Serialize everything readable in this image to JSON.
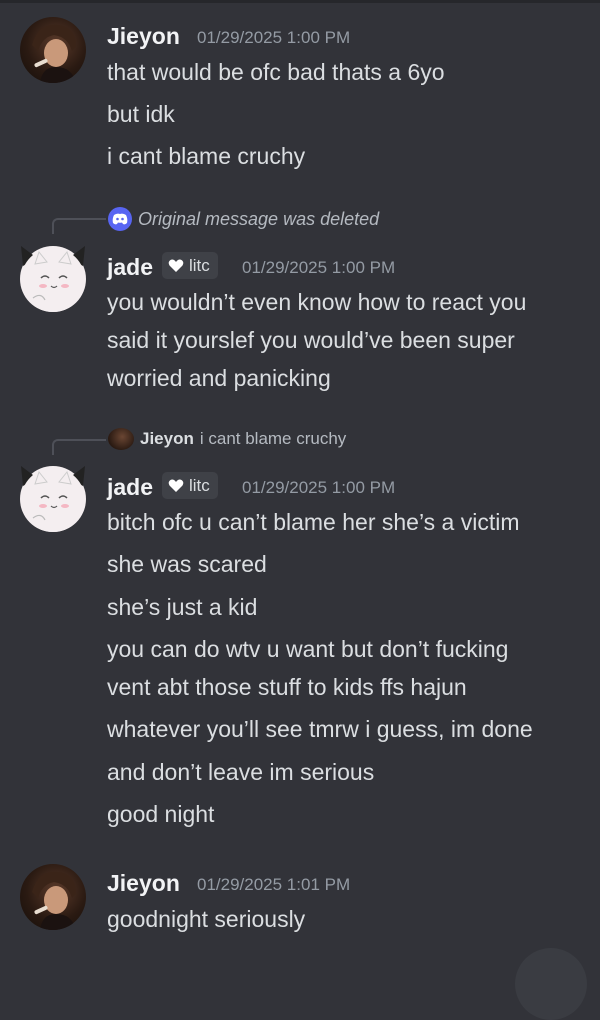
{
  "messages": [
    {
      "author": "Jieyon",
      "timestamp": "01/29/2025 1:00 PM",
      "lines": [
        "that would be ofc bad thats a 6yo",
        "but idk",
        "i cant blame cruchy"
      ]
    },
    {
      "reply": {
        "text": "Original message was deleted"
      },
      "author": "jade",
      "tag": "litc",
      "timestamp": "01/29/2025 1:00 PM",
      "lines": [
        "you wouldn’t even know how to react you",
        "said it yourslef you would’ve been super",
        "worried and panicking"
      ]
    },
    {
      "reply": {
        "author": "Jieyon",
        "text": "i cant blame cruchy"
      },
      "author": "jade",
      "tag": "litc",
      "timestamp": "01/29/2025 1:00 PM",
      "lines": [
        "bitch ofc u can’t blame her she’s a victim",
        "she was scared",
        "she’s just a kid",
        "you can do wtv u want but don’t fucking",
        "vent abt those stuff to kids ffs hajun",
        "whatever you’ll see tmrw i guess, im done",
        "and don’t leave im serious",
        "good night"
      ]
    },
    {
      "author": "Jieyon",
      "timestamp": "01/29/2025 1:01 PM",
      "lines": [
        "goodnight seriously"
      ]
    }
  ],
  "icons": {
    "discord": "discord-logo-icon",
    "heart": "heart-icon"
  },
  "colors": {
    "background": "#323339",
    "username": "#f2f3f5",
    "timestamp": "#949ba4",
    "text": "#dbdee1",
    "discord_blurple": "#5865f2",
    "tag_bg": "#3f4147"
  }
}
